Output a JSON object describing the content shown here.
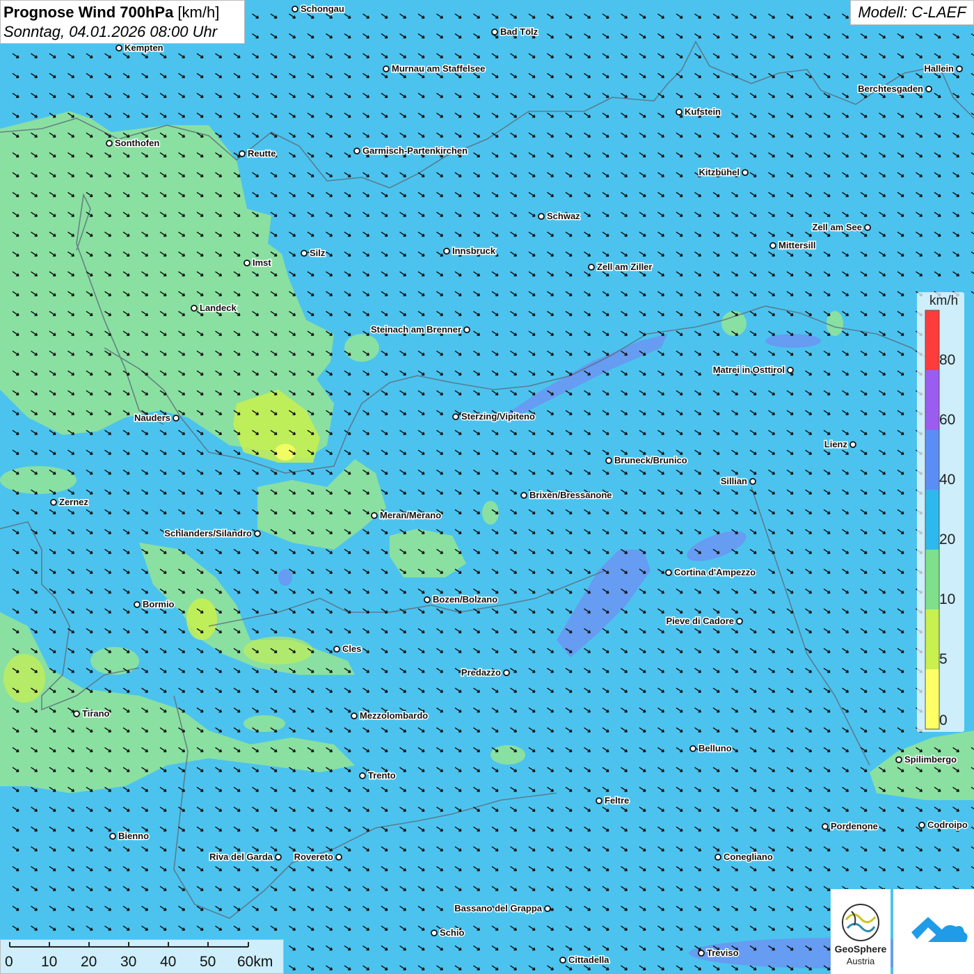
{
  "header": {
    "title_bold": "Prognose Wind 700hPa",
    "title_unit": " [km/h]",
    "datetime": "Sonntag, 04.01.2026 08:00 Uhr",
    "model": "Modell: C-LAEF"
  },
  "legend": {
    "unit": "km/h",
    "labels": [
      "80",
      "60",
      "40",
      "20",
      "10",
      "5",
      "0"
    ],
    "bands": [
      "#ff3b3b",
      "#9b5cf0",
      "#5b8ef5",
      "#2db8ee",
      "#7ee08a",
      "#c8f04f",
      "#ffff66"
    ]
  },
  "scalebar": {
    "labels": [
      "0",
      "10",
      "20",
      "30",
      "40",
      "50",
      "60km"
    ]
  },
  "logos": {
    "geosphere_line1": "GeoSphere",
    "geosphere_line2": "Austria"
  },
  "cities": [
    {
      "name": "Schongau"
    },
    {
      "name": "Bad Tölz"
    },
    {
      "name": "Kempten"
    },
    {
      "name": "Murnau am Staffelsee"
    },
    {
      "name": "Hallein"
    },
    {
      "name": "Berchtesgaden"
    },
    {
      "name": "Kufstein"
    },
    {
      "name": "Sonthofen"
    },
    {
      "name": "Reutte"
    },
    {
      "name": "Garmisch-Partenkirchen"
    },
    {
      "name": "Kitzbühel"
    },
    {
      "name": "Schwaz"
    },
    {
      "name": "Zell am See"
    },
    {
      "name": "Mittersill"
    },
    {
      "name": "Silz"
    },
    {
      "name": "Innsbruck"
    },
    {
      "name": "Imst"
    },
    {
      "name": "Zell am Ziller"
    },
    {
      "name": "Landeck"
    },
    {
      "name": "Steinach am Brenner"
    },
    {
      "name": "Matrei in Osttirol"
    },
    {
      "name": "Nauders"
    },
    {
      "name": "Sterzing/Vipiteno"
    },
    {
      "name": "Lienz"
    },
    {
      "name": "Bruneck/Brunico"
    },
    {
      "name": "Sillian"
    },
    {
      "name": "Zernez"
    },
    {
      "name": "Brixen/Bressanone"
    },
    {
      "name": "Meran/Merano"
    },
    {
      "name": "Schlanders/Silandro"
    },
    {
      "name": "Cortina d'Ampezzo"
    },
    {
      "name": "Bozen/Bolzano"
    },
    {
      "name": "Bormio"
    },
    {
      "name": "Pieve di Cadore"
    },
    {
      "name": "Cles"
    },
    {
      "name": "Predazzo"
    },
    {
      "name": "Tirano"
    },
    {
      "name": "Mezzolombardo"
    },
    {
      "name": "Belluno"
    },
    {
      "name": "Spilimbergo"
    },
    {
      "name": "Trento"
    },
    {
      "name": "Feltre"
    },
    {
      "name": "Bienno"
    },
    {
      "name": "Pordenone"
    },
    {
      "name": "Codroipo"
    },
    {
      "name": "Riva del Garda"
    },
    {
      "name": "Rovereto"
    },
    {
      "name": "Conegliano"
    },
    {
      "name": "Bassano del Grappa"
    },
    {
      "name": "Schio"
    },
    {
      "name": "Treviso"
    },
    {
      "name": "Cittadella"
    }
  ]
}
